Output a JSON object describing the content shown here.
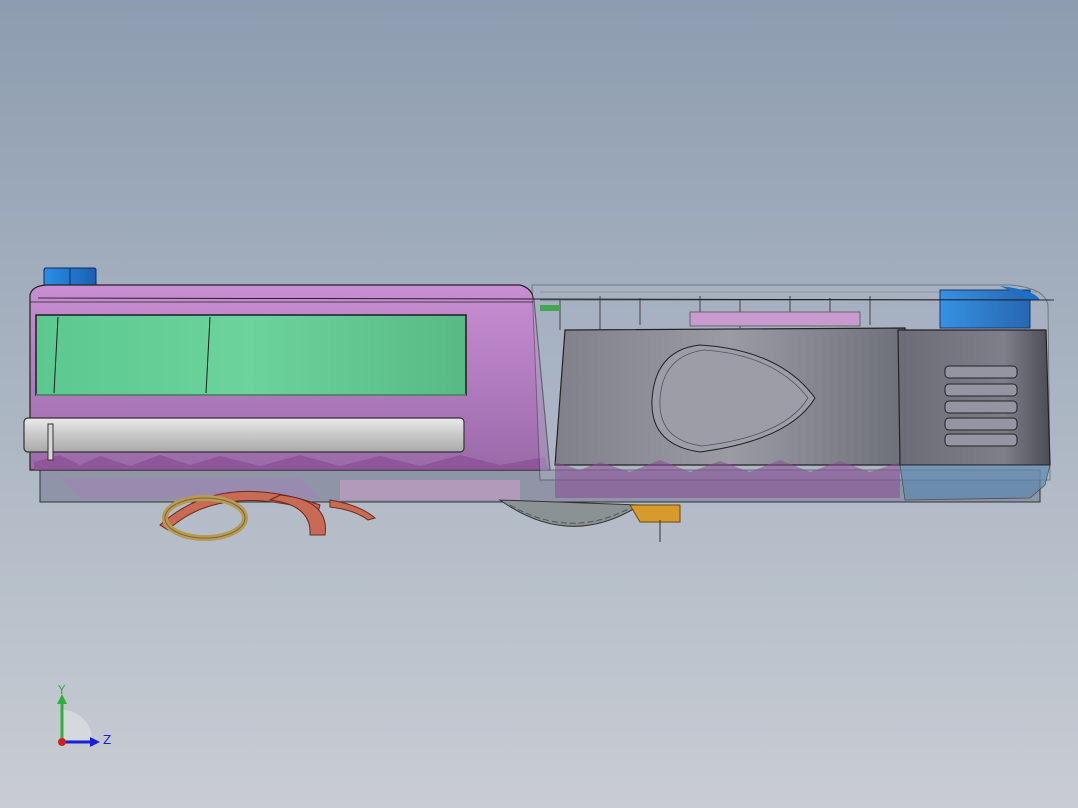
{
  "viewport": {
    "background_top": "#8d9cb0",
    "background_bottom": "#c9cdd3"
  },
  "model": {
    "body_color": "#b57fc0",
    "screen_color": "#66cf96",
    "housing_color": "#8e8f98",
    "accent_color": "#1e7fd6",
    "brush_color": "#c96a54",
    "wheel_color": "#808a8c"
  },
  "triad": {
    "y_label": "Y",
    "z_label": "Z",
    "y_color": "#2fb03a",
    "z_color": "#1a1fd6",
    "origin_color": "#d11f1f"
  }
}
